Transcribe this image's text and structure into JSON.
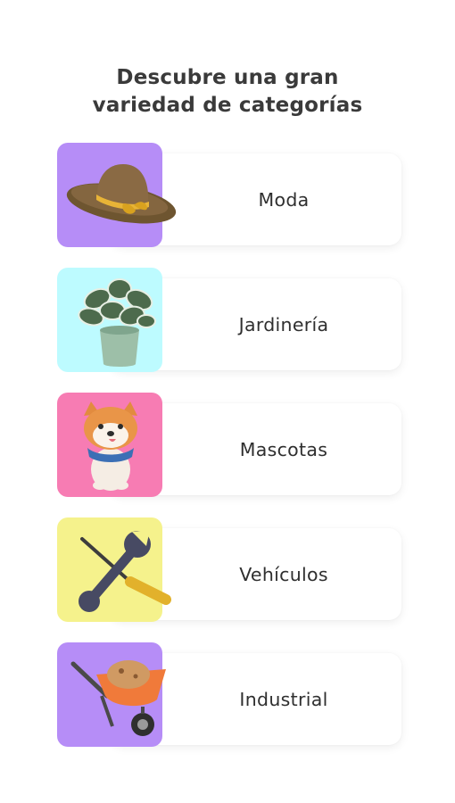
{
  "header": {
    "title_line1": "Descubre una gran",
    "title_line2": "variedad de categorías"
  },
  "categories": [
    {
      "label": "Moda",
      "icon": "hat-icon",
      "tile_color": "#b68df7"
    },
    {
      "label": "Jardinería",
      "icon": "potted-plant-icon",
      "tile_color": "#bdfbff"
    },
    {
      "label": "Mascotas",
      "icon": "shiba-dog-icon",
      "tile_color": "#f77cb3"
    },
    {
      "label": "Vehículos",
      "icon": "wrench-screwdriver-icon",
      "tile_color": "#f5f28c"
    },
    {
      "label": "Industrial",
      "icon": "wheelbarrow-icon",
      "tile_color": "#b68df7"
    }
  ]
}
